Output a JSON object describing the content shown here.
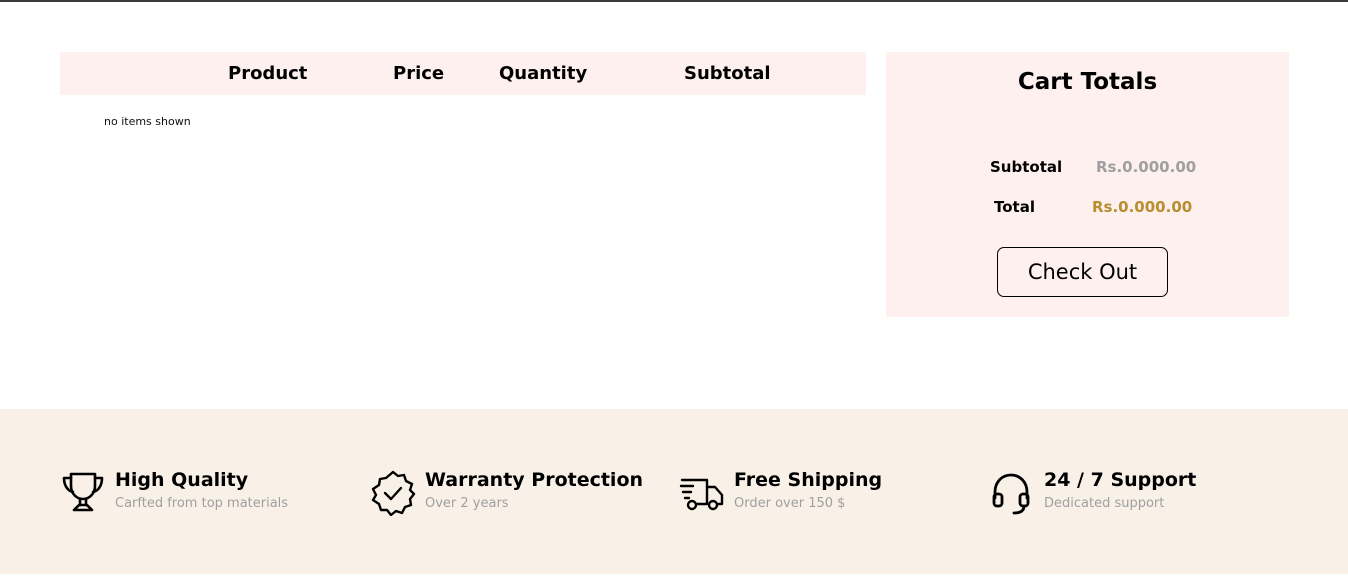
{
  "cart": {
    "columns": [
      "Product",
      "Price",
      "Quantity",
      "Subtotal"
    ],
    "empty_message": "no items shown"
  },
  "totals": {
    "title": "Cart Totals",
    "subtotal_label": "Subtotal",
    "subtotal_value": "Rs.0.000.00",
    "total_label": "Total",
    "total_value": "Rs.0.000.00",
    "checkout_label": "Check Out"
  },
  "features": [
    {
      "icon": "trophy-icon",
      "title": "High Quality",
      "subtitle": "Carfted from top materials"
    },
    {
      "icon": "verified-badge-icon",
      "title": "Warranty Protection",
      "subtitle": "Over 2 years"
    },
    {
      "icon": "delivery-truck-icon",
      "title": "Free Shipping",
      "subtitle": "Order over 150 $"
    },
    {
      "icon": "headset-icon",
      "title": "24 / 7 Support",
      "subtitle": "Dedicated support"
    }
  ],
  "colors": {
    "table_header_bg": "#fdf0ef",
    "totals_bg": "#fdf0ef",
    "features_bg": "#f9f1e7",
    "muted_text": "#9f9f9f",
    "accent_gold": "#b88e2f"
  }
}
